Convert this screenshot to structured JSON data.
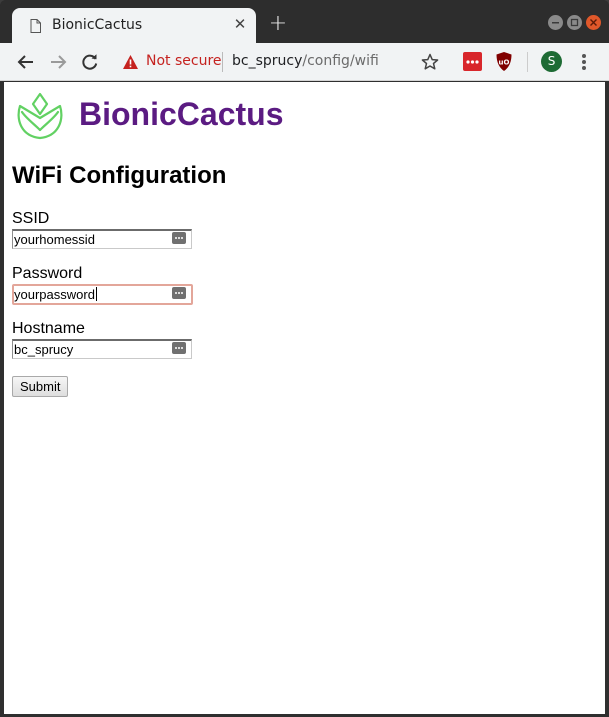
{
  "browser": {
    "tab_title": "BionicCactus",
    "security_label": "Not secure",
    "url_host": "bc_sprucy",
    "url_path": "/config/wifi",
    "profile_initial": "S",
    "colors": {
      "security_warning": "#c5221f",
      "close_button": "#e0582a"
    }
  },
  "page": {
    "brand_name": "BionicCactus",
    "brand_color": "#5b1b82",
    "logo_color": "#62d163",
    "heading": "WiFi Configuration",
    "form": {
      "fields": [
        {
          "label": "SSID",
          "value": "yourhomessid"
        },
        {
          "label": "Password",
          "value": "yourpassword"
        },
        {
          "label": "Hostname",
          "value": "bc_sprucy"
        }
      ],
      "submit_label": "Submit"
    }
  }
}
